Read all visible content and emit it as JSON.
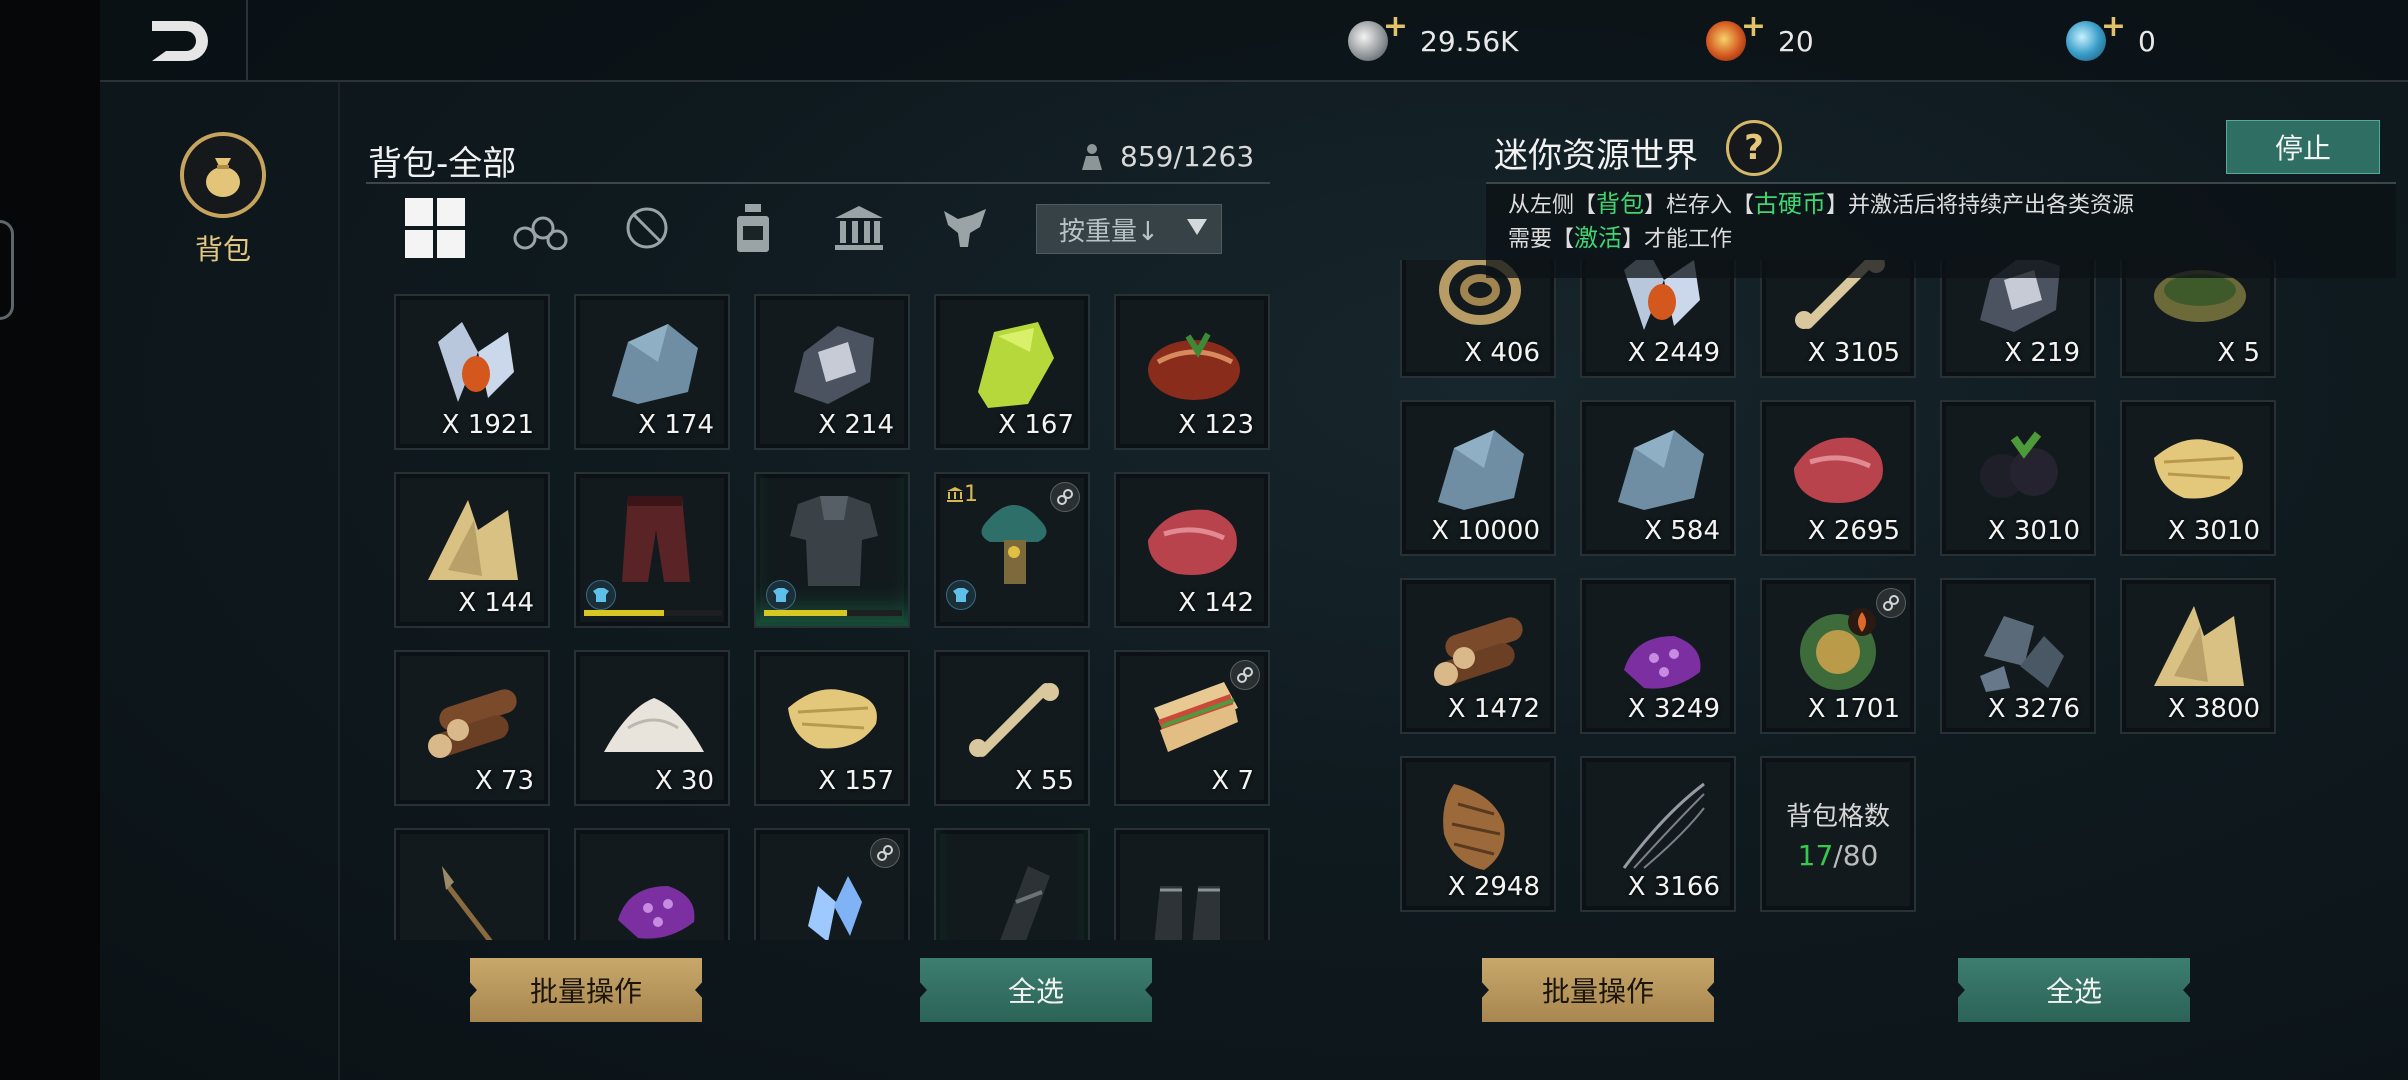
{
  "topbar": {
    "currencies": [
      {
        "icon": "silver-coin-icon",
        "value": "29.56K"
      },
      {
        "icon": "red-gem-icon",
        "value": "20"
      },
      {
        "icon": "blue-orb-icon",
        "value": "0"
      }
    ]
  },
  "sidebar": {
    "bag_label": "背包"
  },
  "left_panel": {
    "title": "背包-全部",
    "capacity": "859/1263",
    "sort_label": "按重量↓",
    "batch_label": "批量操作",
    "select_all_label": "全选",
    "filters": [
      "all-icon",
      "wood-icon",
      "no-tool-icon",
      "potion-icon",
      "building-icon",
      "pet-icon"
    ],
    "items": [
      {
        "name": "orange-crystal",
        "qty": "X 1921"
      },
      {
        "name": "blue-stone",
        "qty": "X 174"
      },
      {
        "name": "metal-ore",
        "qty": "X 214"
      },
      {
        "name": "green-slime",
        "qty": "X 167"
      },
      {
        "name": "cooked-meat",
        "qty": "X 123"
      },
      {
        "name": "fiber-bundle",
        "qty": "X 144"
      },
      {
        "name": "leather-pants",
        "qty": "",
        "progress": 0.58
      },
      {
        "name": "chest-armor",
        "qty": "",
        "progress": 0.6
      },
      {
        "name": "tree-totem",
        "qty": "",
        "tag": "1"
      },
      {
        "name": "raw-meat",
        "qty": "X 142"
      },
      {
        "name": "wood-logs",
        "qty": "X 73"
      },
      {
        "name": "flour-pile",
        "qty": "X 30"
      },
      {
        "name": "straw",
        "qty": "X 157"
      },
      {
        "name": "bone",
        "qty": "X 55"
      },
      {
        "name": "sandwich",
        "qty": "X 7"
      },
      {
        "name": "spear",
        "qty": ""
      },
      {
        "name": "purple-egg",
        "qty": ""
      },
      {
        "name": "ice-crystal",
        "qty": ""
      },
      {
        "name": "bracer",
        "qty": ""
      },
      {
        "name": "boots",
        "qty": ""
      }
    ]
  },
  "right_panel": {
    "title": "迷你资源世界",
    "stop_label": "停止",
    "desc_line1_a": "从左侧【",
    "desc_line1_b": "背包",
    "desc_line1_c": "】栏存入【",
    "desc_line1_d": "古硬币",
    "desc_line1_e": "】并激活后将持续产出各类资源",
    "desc_line2_a": "需要【",
    "desc_line2_b": "激活",
    "desc_line2_c": "】才能工作",
    "capacity_title": "背包格数",
    "capacity_used": "17",
    "capacity_total": "/80",
    "batch_label": "批量操作",
    "select_all_label": "全选",
    "items": [
      {
        "name": "rope",
        "qty": "X 406"
      },
      {
        "name": "orange-crystal",
        "qty": "X 2449"
      },
      {
        "name": "bone",
        "qty": "X 3105"
      },
      {
        "name": "metal-ore",
        "qty": "X 219"
      },
      {
        "name": "woven-basket",
        "qty": "X 5"
      },
      {
        "name": "blue-stone",
        "qty": "X 10000"
      },
      {
        "name": "blue-stone",
        "qty": "X 584"
      },
      {
        "name": "raw-meat",
        "qty": "X 2695"
      },
      {
        "name": "blackberry",
        "qty": "X 3010"
      },
      {
        "name": "straw",
        "qty": "X 3010"
      },
      {
        "name": "wood-logs",
        "qty": "X 1472"
      },
      {
        "name": "purple-egg",
        "qty": "X 3249"
      },
      {
        "name": "green-medallion",
        "qty": "X 1701"
      },
      {
        "name": "iron-chunks",
        "qty": "X 3276"
      },
      {
        "name": "fiber-bundle",
        "qty": "X 3800"
      },
      {
        "name": "snake-skin",
        "qty": "X 2948"
      },
      {
        "name": "spider-web",
        "qty": "X 3166"
      }
    ]
  }
}
